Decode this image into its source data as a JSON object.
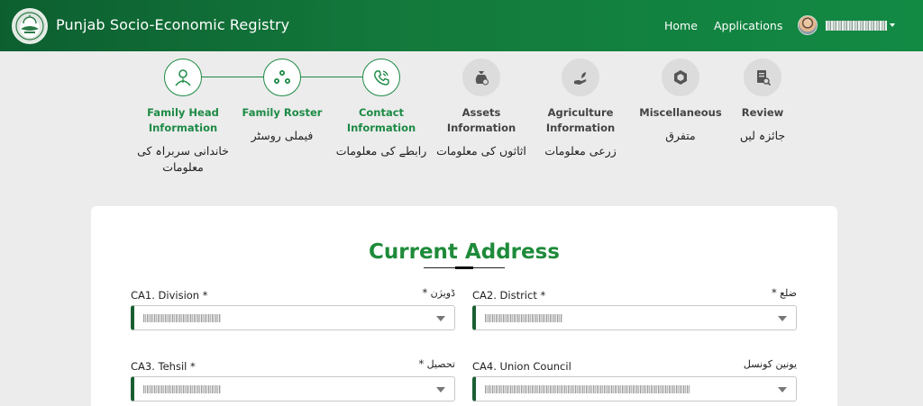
{
  "header": {
    "app_title": "Punjab Socio-Economic Registry",
    "nav": [
      {
        "label": "Home"
      },
      {
        "label": "Applications"
      }
    ],
    "brand_color": "#137a3c"
  },
  "stepper": {
    "steps": [
      {
        "label_line1": "Family Head",
        "label_line2": "Information",
        "urdu_line1": "خاندانی سربراہ کی",
        "urdu_line2": "معلومات",
        "status": "completed",
        "icon": "person-icon"
      },
      {
        "label_line1": "Family Roster",
        "label_line2": "",
        "urdu_line1": "فیملی روسٹر",
        "urdu_line2": "",
        "status": "completed",
        "icon": "group-icon"
      },
      {
        "label_line1": "Contact",
        "label_line2": "Information",
        "urdu_line1": "رابطے کی معلومات",
        "urdu_line2": "",
        "status": "completed",
        "icon": "phone-icon"
      },
      {
        "label_line1": "Assets",
        "label_line2": "Information",
        "urdu_line1": "اثاثوں کی معلومات",
        "urdu_line2": "",
        "status": "pending",
        "icon": "money-bag-icon"
      },
      {
        "label_line1": "Agriculture",
        "label_line2": "Information",
        "urdu_line1": "زرعی معلومات",
        "urdu_line2": "",
        "status": "pending",
        "icon": "hand-plant-icon"
      },
      {
        "label_line1": "Miscellaneous",
        "label_line2": "",
        "urdu_line1": "متفرق",
        "urdu_line2": "",
        "status": "pending",
        "icon": "cube-icon"
      },
      {
        "label_line1": "Review",
        "label_line2": "",
        "urdu_line1": "جائزہ لیں",
        "urdu_line2": "",
        "status": "pending",
        "icon": "document-search-icon"
      }
    ],
    "active_color": "#1d8a45",
    "pending_color": "#dcdcdc"
  },
  "form": {
    "section_title": "Current Address",
    "fields": [
      {
        "label": "CA1. Division *",
        "urdu": "ڈویژن *"
      },
      {
        "label": "CA2. District *",
        "urdu": "ضلع *"
      },
      {
        "label": "CA3. Tehsil *",
        "urdu": "تحصیل *"
      },
      {
        "label": "CA4. Union Council",
        "urdu": "یونین کونسل"
      }
    ]
  }
}
